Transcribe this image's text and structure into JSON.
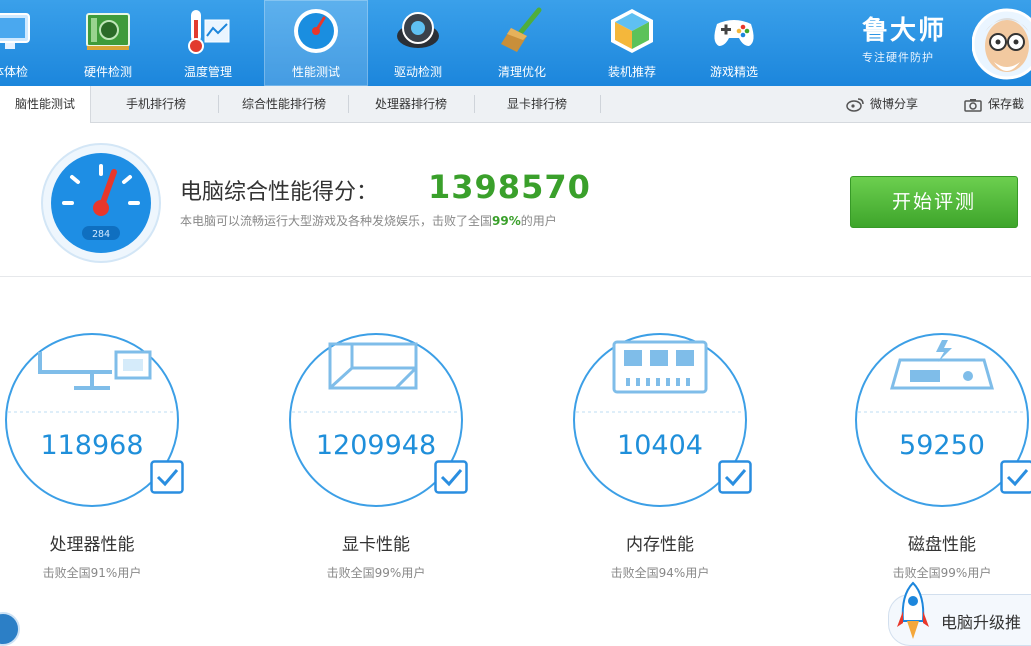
{
  "toolbar": {
    "items": [
      {
        "label": "体体检",
        "icon": "monitor-icon"
      },
      {
        "label": "硬件检测",
        "icon": "circuit-board-icon"
      },
      {
        "label": "温度管理",
        "icon": "thermometer-icon"
      },
      {
        "label": "性能测试",
        "icon": "speedometer-icon",
        "active": true
      },
      {
        "label": "驱动检测",
        "icon": "gear-disk-icon"
      },
      {
        "label": "清理优化",
        "icon": "broom-icon"
      },
      {
        "label": "装机推荐",
        "icon": "cube-icon"
      },
      {
        "label": "游戏精选",
        "icon": "gamepad-icon"
      }
    ],
    "brand_name": "鲁大师",
    "brand_slogan": "专注硬件防护"
  },
  "tabs": {
    "items": [
      "脑性能测试",
      "手机排行榜",
      "综合性能排行榜",
      "处理器排行榜",
      "显卡排行榜"
    ],
    "share_weibo": "微博分享",
    "save": "保存截"
  },
  "score": {
    "title": "电脑综合性能得分：",
    "value": "1398570",
    "desc_prefix": "本电脑可以流畅运行大型游戏及各种发烧娱乐，击败了全国",
    "desc_percent": "99%",
    "desc_suffix": "的用户",
    "gauge_label": "284",
    "start_button": "开始评测"
  },
  "components": [
    {
      "value": "118968",
      "title": "处理器性能",
      "sub": "击败全国91%用户",
      "icon": "cpu-monitor-icon"
    },
    {
      "value": "1209948",
      "title": "显卡性能",
      "sub": "击败全国99%用户",
      "icon": "gpu-cube-icon"
    },
    {
      "value": "10404",
      "title": "内存性能",
      "sub": "击败全国94%用户",
      "icon": "memory-chip-icon"
    },
    {
      "value": "59250",
      "title": "磁盘性能",
      "sub": "击败全国99%用户",
      "icon": "hard-disk-icon"
    }
  ],
  "upgrade": {
    "label": "电脑升级推"
  },
  "colors": {
    "toolbar": "#1c86dc",
    "accent_green": "#3aa02b",
    "value_blue": "#1f8fda"
  }
}
